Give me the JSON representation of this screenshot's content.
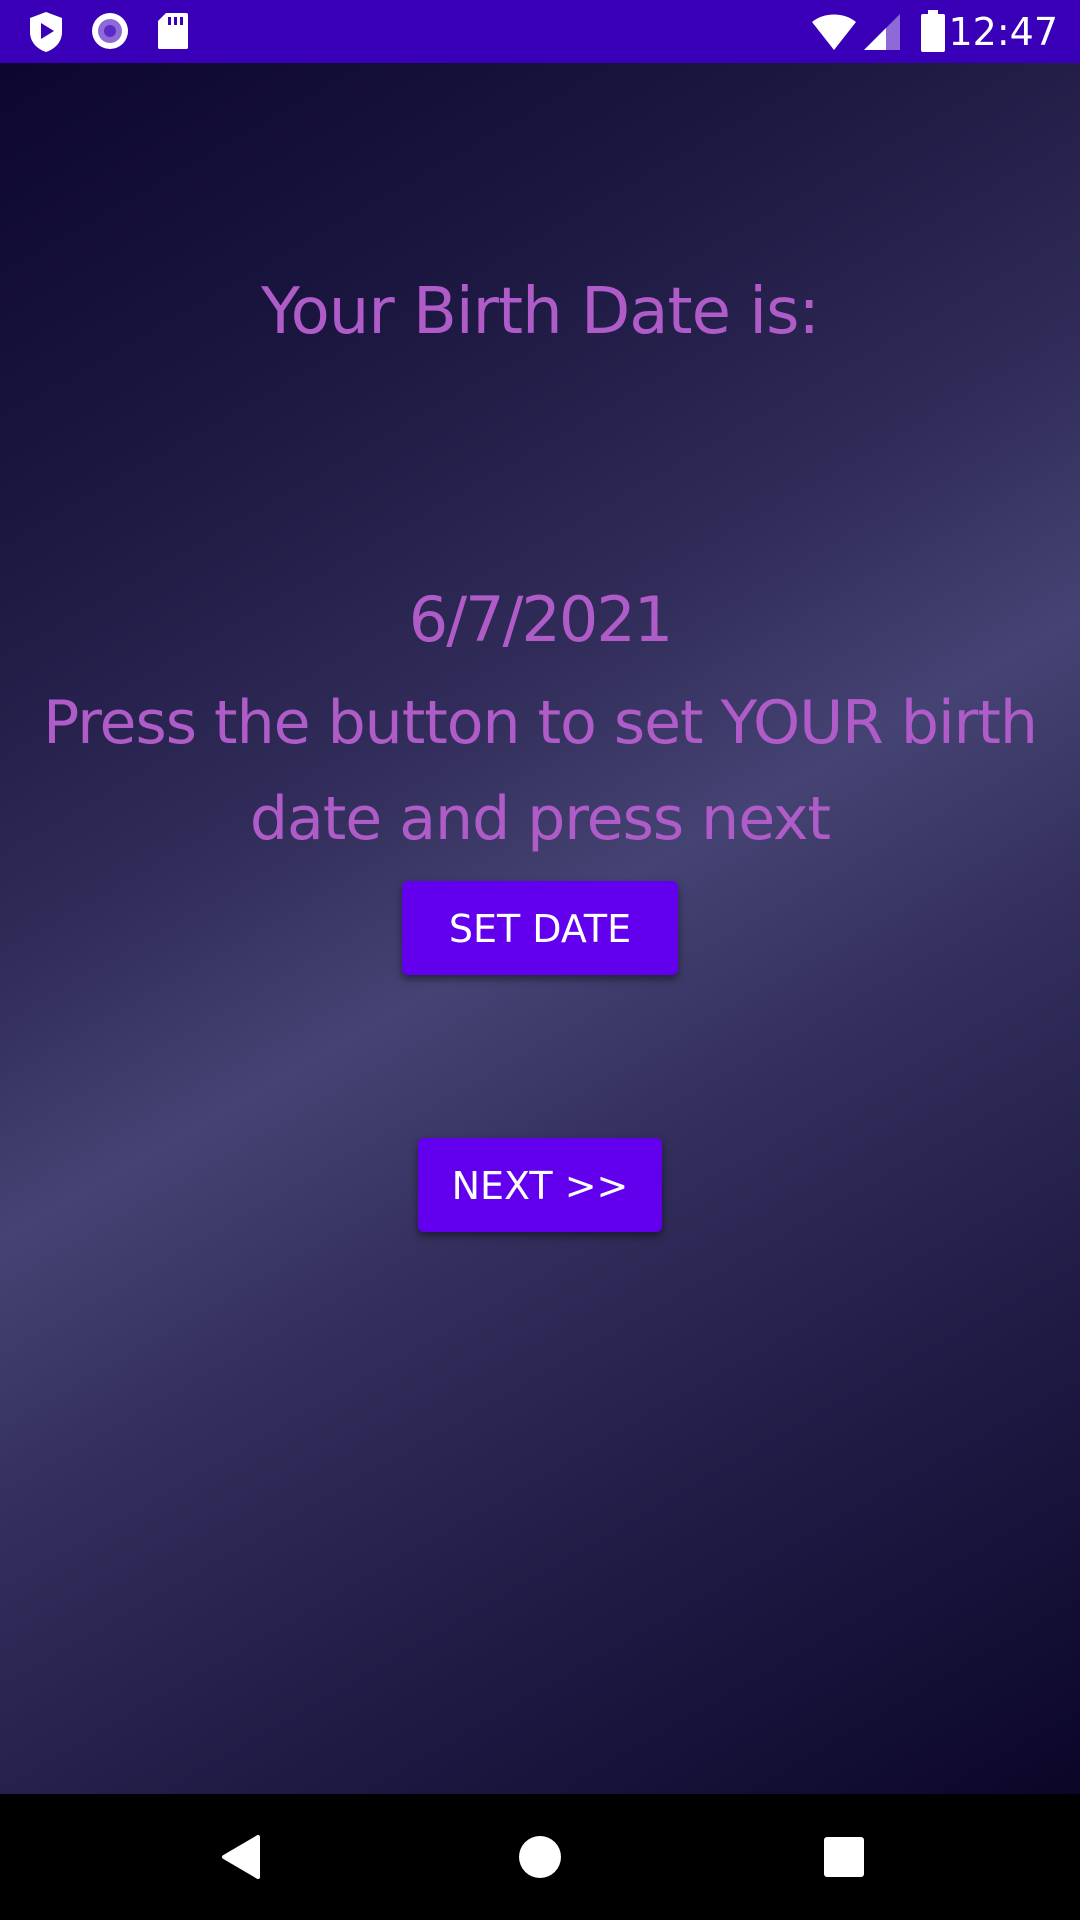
{
  "status_bar": {
    "time": "12:47",
    "background": "#3a00b8",
    "left_icons": [
      "play-protect-icon",
      "radio-record-icon",
      "sd-card-icon"
    ],
    "right_icons": [
      "wifi-icon",
      "cell-signal-icon",
      "battery-icon"
    ]
  },
  "main": {
    "title": "Your Birth Date is:",
    "date_value": "6/7/2021",
    "instructions": "Press the button to set YOUR birth date and press next",
    "text_color": "#b05cc8",
    "set_date_button": "SET DATE",
    "next_button": "NEXT >>",
    "button_color": "#6200ee"
  },
  "nav_bar": {
    "icons": [
      "back-icon",
      "home-icon",
      "recents-icon"
    ]
  }
}
